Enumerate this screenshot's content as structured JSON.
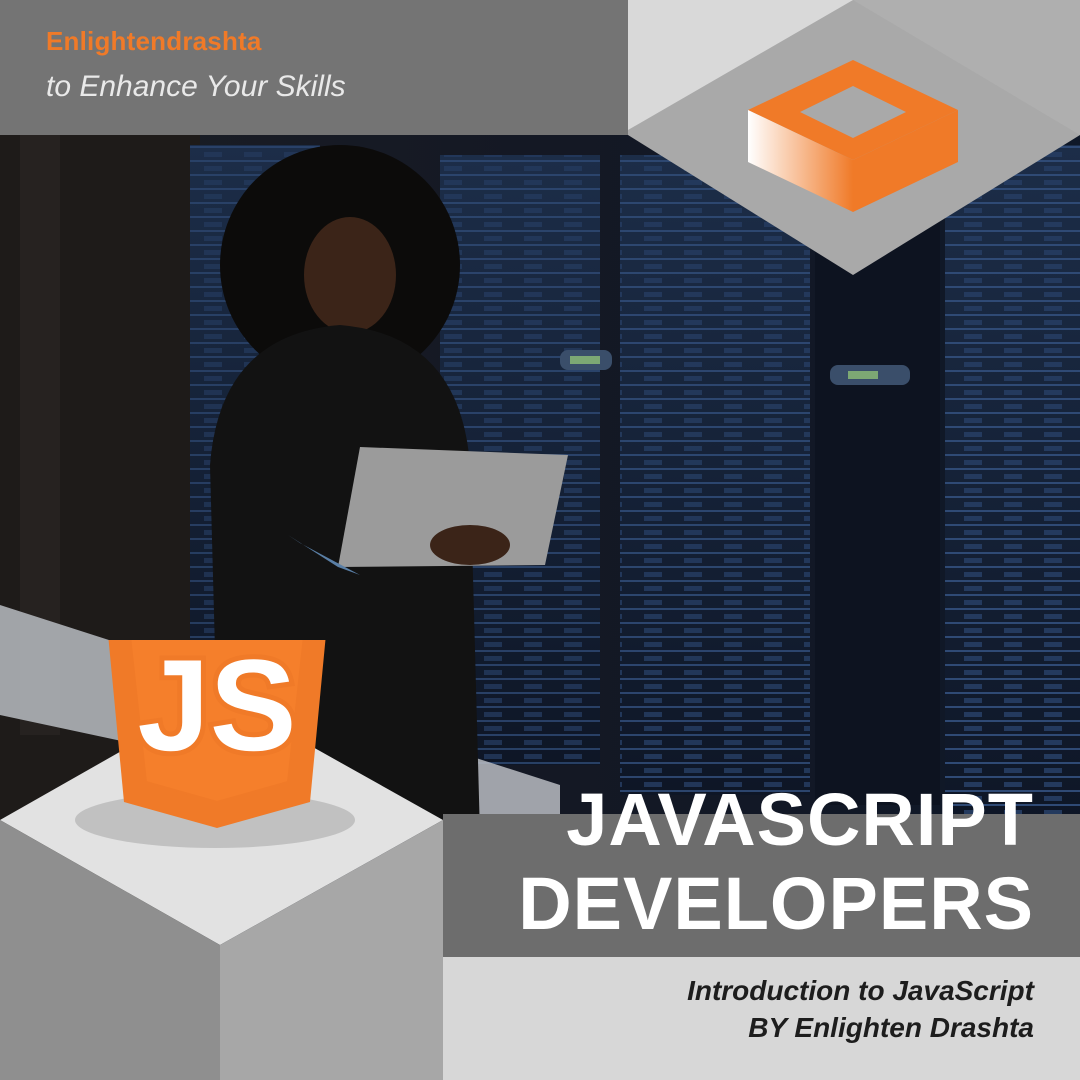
{
  "header": {
    "brand": "Enlightendrashta",
    "tagline": "to Enhance Your Skills"
  },
  "hero": {
    "title_line1": "JAVASCRIPT",
    "title_line2": "DEVELOPERS",
    "subtitle_line1": "Introduction to JavaScript",
    "subtitle_line2": "BY Enlighten Drashta"
  },
  "icons": {
    "logo": "orange-open-box-icon",
    "badge": "javascript-shield-icon",
    "badge_text": "JS"
  },
  "colors": {
    "accent": "#f07a28",
    "header_bg": "#747474",
    "band_bg": "#6d6d6d",
    "light_bg": "#d7d7d7",
    "title_text": "#ffffff"
  }
}
